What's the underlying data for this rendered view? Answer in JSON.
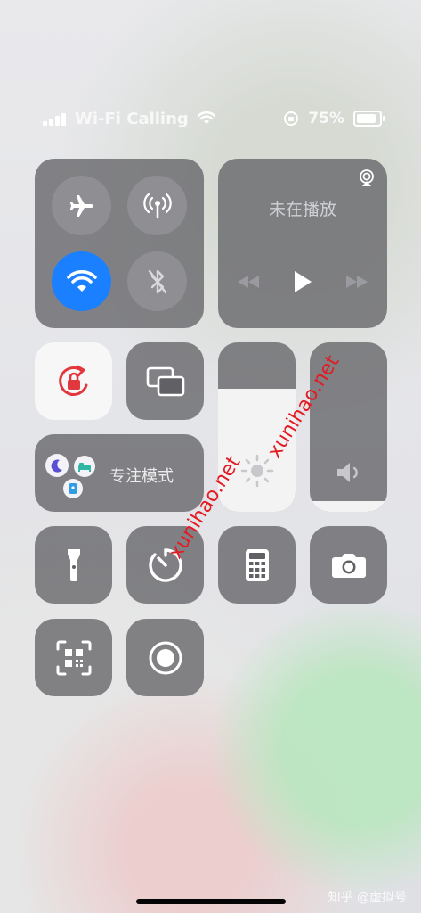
{
  "status": {
    "carrier": "Wi-Fi Calling",
    "battery": "75%"
  },
  "music": {
    "title": "未在播放"
  },
  "focus": {
    "label": "专注模式"
  },
  "watermarks": [
    "xunihao.net",
    "xunihao.net"
  ],
  "footer": {
    "brand": "知乎 @虚拟号"
  },
  "colors": {
    "active": "#1a80ff",
    "rotation_lock": "#e0383e"
  }
}
